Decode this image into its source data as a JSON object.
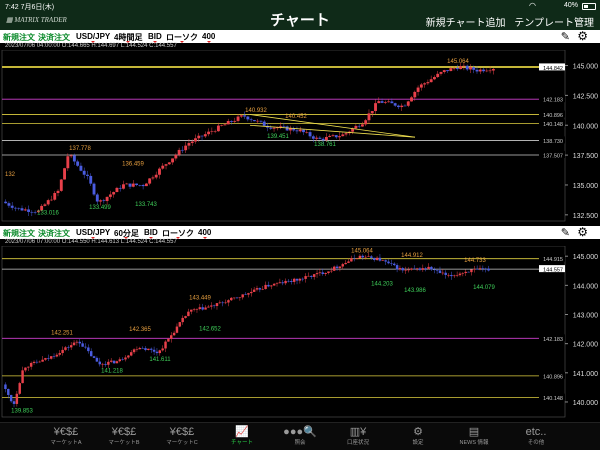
{
  "status": {
    "time": "7:42",
    "date": "7月6日(木)",
    "battery": "40%"
  },
  "app": {
    "logo": "MATRIX TRADER",
    "title": "チャート",
    "add_chart": "新規チャート追加",
    "template": "テンプレート管理"
  },
  "panels": [
    {
      "new_order": "新規注文",
      "settle_order": "決済注文",
      "pair": "USD/JPY",
      "timeframe": "4時間足",
      "side": "BID",
      "chart_type": "ローソク",
      "count": "400",
      "info": "2023/07/06 04:00:00  O:144.665  H:144.697  L:144.524  C:144.557",
      "axis_labels": [
        "145.000",
        "142.500",
        "140.000",
        "137.500",
        "135.000",
        "132.500"
      ],
      "level_labels": [
        "144.915",
        "144.842",
        "142.183",
        "140.896",
        "140.148",
        "138.730",
        "137.507"
      ],
      "price_labels": [
        "145.064",
        "140.932",
        "140.452",
        "139.451",
        "138.761",
        "137.778",
        "136.459",
        "133.499",
        "133.743",
        "133.016",
        "132"
      ]
    },
    {
      "new_order": "新規注文",
      "settle_order": "決済注文",
      "pair": "USD/JPY",
      "timeframe": "60分足",
      "side": "BID",
      "chart_type": "ローソク",
      "count": "400",
      "info": "2023/07/06 07:00:00  O:144.550  H:144.613  L:144.524  C:144.557",
      "axis_labels": [
        "145.000",
        "144.000",
        "143.000",
        "142.000",
        "141.000",
        "140.000"
      ],
      "level_labels": [
        "144.915",
        "144.557",
        "142.183",
        "140.896",
        "140.148"
      ],
      "price_labels": [
        "145.064",
        "144.912",
        "144.733",
        "144.203",
        "143.986",
        "144.079",
        "143.449",
        "142.652",
        "142.251",
        "142.365",
        "141.611",
        "141.218",
        "139.853"
      ]
    }
  ],
  "tabs": [
    {
      "icon": "¥€$£",
      "label": "マーケットA",
      "icon_name": "currency-icon"
    },
    {
      "icon": "¥€$£",
      "label": "マーケットB",
      "icon_name": "currency-icon"
    },
    {
      "icon": "¥€$£",
      "label": "マーケットC",
      "icon_name": "currency-icon"
    },
    {
      "icon": "📈",
      "label": "チャート",
      "icon_name": "chart-icon"
    },
    {
      "icon": "●●●🔍",
      "label": "照会",
      "icon_name": "search-icon"
    },
    {
      "icon": "▥¥",
      "label": "口座状況",
      "icon_name": "account-icon"
    },
    {
      "icon": "⚙",
      "label": "設定",
      "icon_name": "settings-icon"
    },
    {
      "icon": "▤",
      "label": "NEWS 情報",
      "icon_name": "news-icon"
    },
    {
      "icon": "etc..",
      "label": "その他",
      "icon_name": "etc-icon"
    }
  ],
  "colors": {
    "header": "#0f2a18",
    "active_tab": "#2bd64a",
    "bull": "#e8404a",
    "bear": "#4a5ce0",
    "trend": "#f0e050"
  }
}
